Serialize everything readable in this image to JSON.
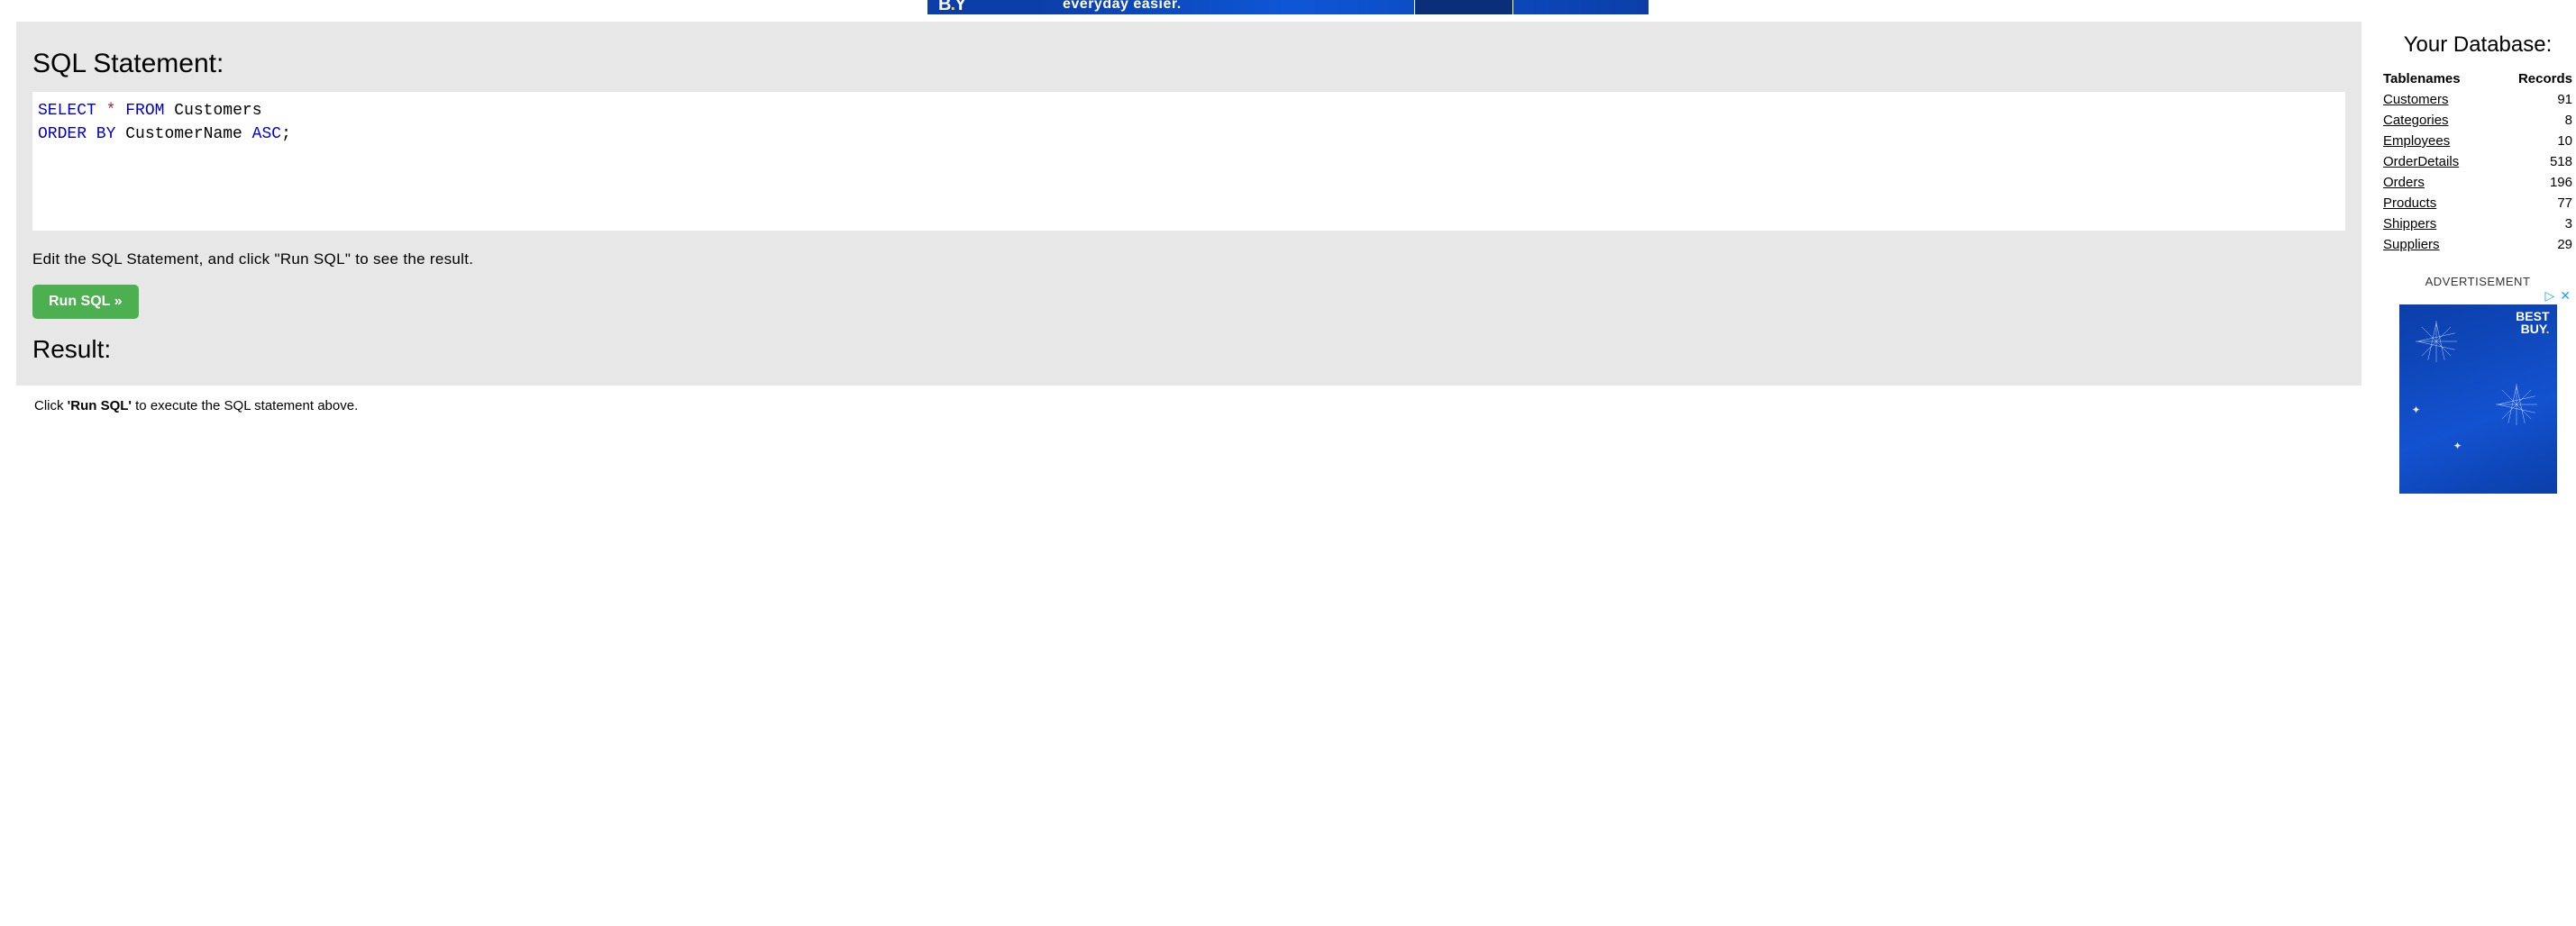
{
  "topAd": {
    "brand_pre": "B",
    "brand_post": "Y",
    "brand_dot": ".",
    "slogan": "everyday easier."
  },
  "sql": {
    "heading": "SQL Statement:",
    "tokens": {
      "select": "SELECT",
      "star": "*",
      "from": "FROM",
      "table": "Customers",
      "orderby": "ORDER BY",
      "col": "CustomerName",
      "dir": "ASC",
      "semi": ";"
    },
    "hint": "Edit the SQL Statement, and click \"Run SQL\" to see the result.",
    "run_label": "Run SQL »"
  },
  "result": {
    "heading": "Result:",
    "pre": "Click ",
    "bold": "'Run SQL'",
    "post": " to execute the SQL statement above."
  },
  "db": {
    "title": "Your Database:",
    "col_name": "Tablenames",
    "col_rec": "Records",
    "tables": [
      {
        "name": "Customers",
        "records": 91
      },
      {
        "name": "Categories",
        "records": 8
      },
      {
        "name": "Employees",
        "records": 10
      },
      {
        "name": "OrderDetails",
        "records": 518
      },
      {
        "name": "Orders",
        "records": 196
      },
      {
        "name": "Products",
        "records": 77
      },
      {
        "name": "Shippers",
        "records": 3
      },
      {
        "name": "Suppliers",
        "records": 29
      }
    ]
  },
  "ad": {
    "label": "ADVERTISEMENT",
    "brand_line1": "BEST",
    "brand_line2": "BUY",
    "brand_dot": "."
  }
}
